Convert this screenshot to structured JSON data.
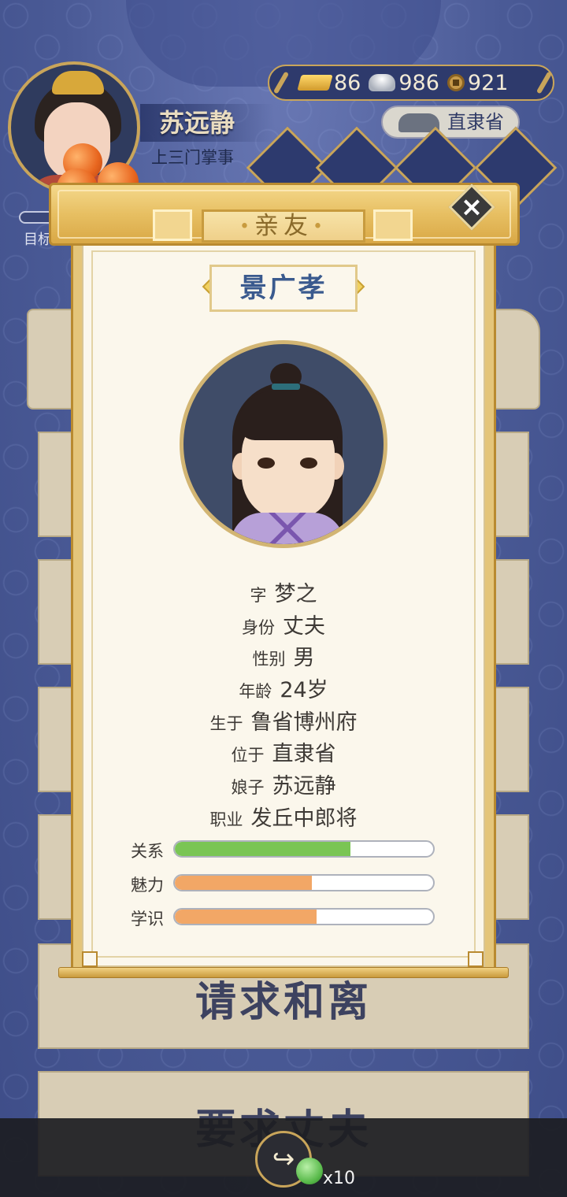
{
  "player": {
    "name": "苏远静",
    "title": "上三门掌事"
  },
  "currency": {
    "gold": "86",
    "silver": "986",
    "coins": "921"
  },
  "location": "直隶省",
  "goal_label": "目标",
  "background_cards": {
    "request_divorce": "请求和离",
    "ask_husband": "要求丈夫"
  },
  "modal": {
    "tab_title": "亲友",
    "character_name": "景广孝",
    "info": [
      {
        "label": "字",
        "value": "梦之"
      },
      {
        "label": "身份",
        "value": "丈夫"
      },
      {
        "label": "性别",
        "value": "男"
      },
      {
        "label": "年龄",
        "value": "24岁"
      },
      {
        "label": "生于",
        "value": "鲁省博州府"
      },
      {
        "label": "位于",
        "value": "直隶省"
      },
      {
        "label": "娘子",
        "value": "苏远静"
      },
      {
        "label": "职业",
        "value": "发丘中郎将"
      }
    ],
    "stats": [
      {
        "label": "关系",
        "fraction": 0.68,
        "color": "#7ac554"
      },
      {
        "label": "魅力",
        "fraction": 0.53,
        "color": "#f2a766"
      },
      {
        "label": "学识",
        "fraction": 0.55,
        "color": "#f2a766"
      }
    ]
  },
  "bottom": {
    "reward_count": "x10"
  }
}
